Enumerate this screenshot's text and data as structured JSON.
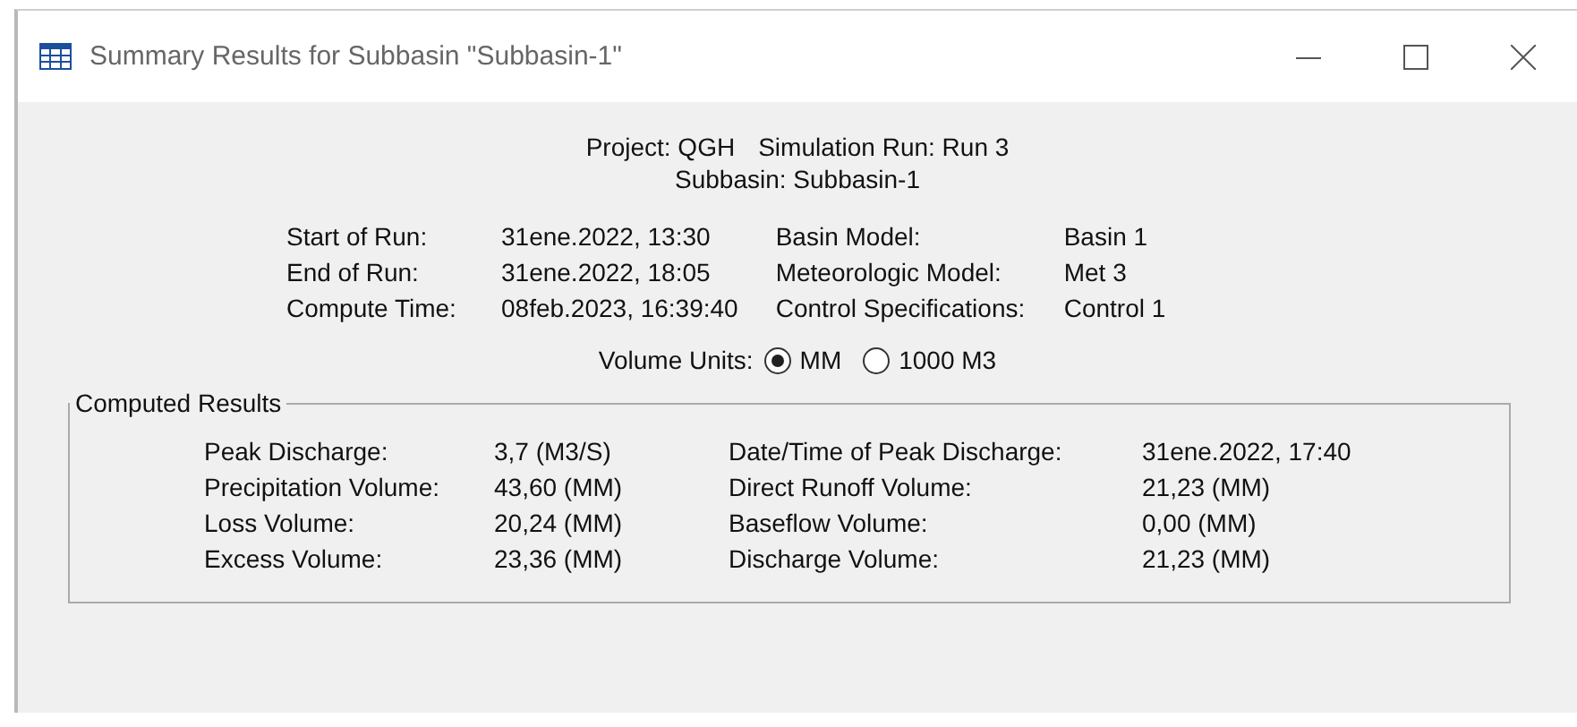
{
  "window": {
    "title": "Summary Results for Subbasin \"Subbasin-1\""
  },
  "header": {
    "project": "Project: QGH",
    "simulation_run": "Simulation Run: Run 3",
    "subbasin": "Subbasin: Subbasin-1"
  },
  "run_info": {
    "left": [
      {
        "label": "Start of Run:",
        "value": "31ene.2022, 13:30"
      },
      {
        "label": "End of Run:",
        "value": "31ene.2022, 18:05"
      },
      {
        "label": "Compute Time:",
        "value": "08feb.2023, 16:39:40"
      }
    ],
    "right": [
      {
        "label": "Basin Model:",
        "value": "Basin 1"
      },
      {
        "label": "Meteorologic Model:",
        "value": "Met 3"
      },
      {
        "label": "Control Specifications:",
        "value": "Control 1"
      }
    ]
  },
  "volume_units": {
    "label": "Volume Units:",
    "options": [
      {
        "label": "MM",
        "selected": true
      },
      {
        "label": "1000 M3",
        "selected": false
      }
    ]
  },
  "computed_results": {
    "title": "Computed Results",
    "left": [
      {
        "label": "Peak Discharge:",
        "value": "3,7 (M3/S)"
      },
      {
        "label": "Precipitation Volume:",
        "value": "43,60 (MM)"
      },
      {
        "label": "Loss Volume:",
        "value": "20,24 (MM)"
      },
      {
        "label": "Excess Volume:",
        "value": "23,36 (MM)"
      }
    ],
    "right": [
      {
        "label": "Date/Time of Peak Discharge:",
        "value": "31ene.2022, 17:40"
      },
      {
        "label": "Direct Runoff Volume:",
        "value": "21,23 (MM)"
      },
      {
        "label": "Baseflow Volume:",
        "value": "0,00 (MM)"
      },
      {
        "label": "Discharge Volume:",
        "value": "21,23 (MM)"
      }
    ]
  }
}
